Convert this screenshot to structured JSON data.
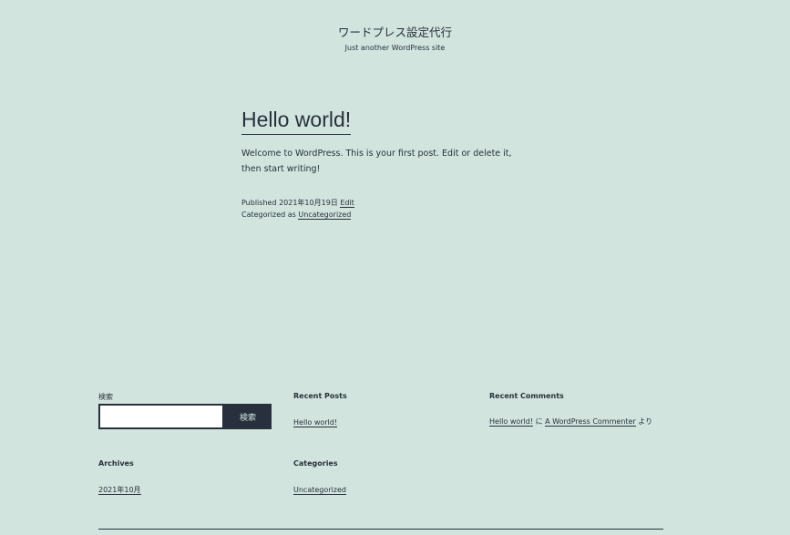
{
  "header": {
    "site_title": "ワードプレス設定代行",
    "tagline": "Just another WordPress site"
  },
  "post": {
    "title": "Hello world!",
    "content": "Welcome to WordPress. This is your first post. Edit or delete it, then start writing!",
    "published_prefix": "Published",
    "published_date": "2021年10月19日",
    "edit_label": "Edit",
    "categorized_prefix": "Categorized as",
    "category": "Uncategorized"
  },
  "search": {
    "label": "検索",
    "button_label": "検索",
    "value": "",
    "placeholder": ""
  },
  "recent_posts": {
    "title": "Recent Posts",
    "items": [
      "Hello world!"
    ]
  },
  "recent_comments": {
    "title": "Recent Comments",
    "post_link": "Hello world!",
    "ni": "に",
    "author": "A WordPress Commenter",
    "yori": "より"
  },
  "archives": {
    "title": "Archives",
    "items": [
      "2021年10月"
    ]
  },
  "categories": {
    "title": "Categories",
    "items": [
      "Uncategorized"
    ]
  },
  "colors": {
    "background": "#d1e4dd",
    "text": "#28303d"
  }
}
